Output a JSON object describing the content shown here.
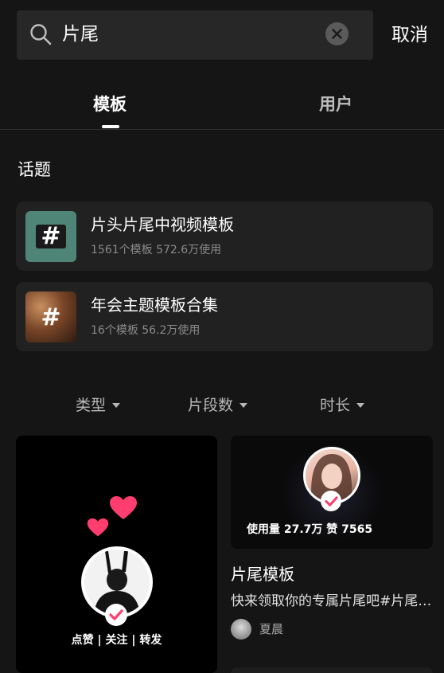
{
  "search": {
    "query": "片尾",
    "cancel_label": "取消"
  },
  "tabs": [
    {
      "label": "模板",
      "active": true
    },
    {
      "label": "用户",
      "active": false
    }
  ],
  "topics_section": {
    "title": "话题",
    "items": [
      {
        "title": "片头片尾中视频模板",
        "meta": "1561个模板 572.6万使用",
        "icon": "hashtag-icon"
      },
      {
        "title": "年会主题模板合集",
        "meta": "16个模板 56.2万使用",
        "icon": "hashtag-icon"
      }
    ]
  },
  "filters": [
    {
      "label": "类型"
    },
    {
      "label": "片段数"
    },
    {
      "label": "时长"
    }
  ],
  "templates": [
    {
      "caption": "点赞 | 关注 | 转发"
    },
    {
      "overlay": "使用量 27.7万 赞 7565",
      "title": "片尾模板",
      "description": "快来领取你的专属片尾吧#片尾#关注",
      "author": "夏晨"
    }
  ],
  "colors": {
    "background": "#151515",
    "card": "#212121",
    "heart": "#ff3d6e",
    "check": "#ff3d6e"
  }
}
